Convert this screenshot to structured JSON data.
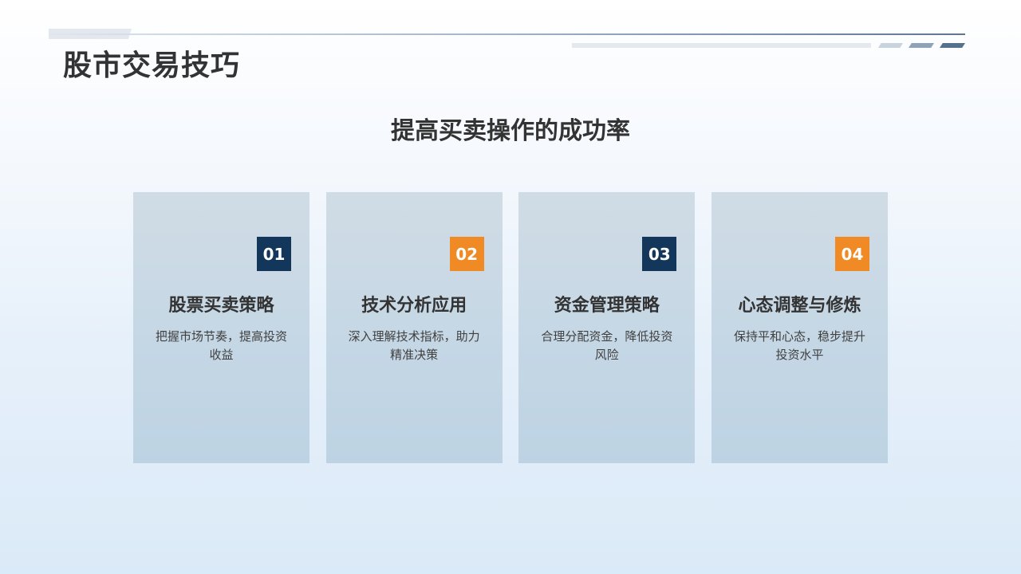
{
  "title": "股市交易技巧",
  "subtitle": "提高买卖操作的成功率",
  "colors": {
    "badge_dark": "#13375a",
    "badge_orange": "#f08a24",
    "text_dark": "#333333"
  },
  "cards": [
    {
      "number": "01",
      "title": "股票买卖策略",
      "description": "把握市场节奏，提高投资收益",
      "badge_color": "#13375a"
    },
    {
      "number": "02",
      "title": "技术分析应用",
      "description": "深入理解技术指标，助力精准决策",
      "badge_color": "#f08a24"
    },
    {
      "number": "03",
      "title": "资金管理策略",
      "description": "合理分配资金，降低投资风险",
      "badge_color": "#13375a"
    },
    {
      "number": "04",
      "title": "心态调整与修炼",
      "description": "保持平和心态，稳步提升投资水平",
      "badge_color": "#f08a24"
    }
  ]
}
